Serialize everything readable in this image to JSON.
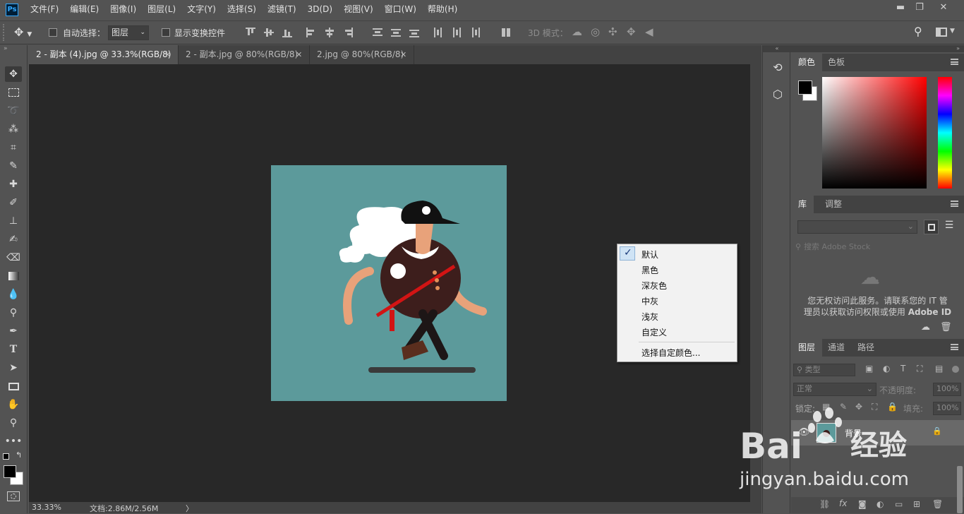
{
  "app": {
    "logo": "Ps"
  },
  "menu": [
    "文件(F)",
    "编辑(E)",
    "图像(I)",
    "图层(L)",
    "文字(Y)",
    "选择(S)",
    "滤镜(T)",
    "3D(D)",
    "视图(V)",
    "窗口(W)",
    "帮助(H)"
  ],
  "window": {
    "minimize": "▬",
    "restore": "❐",
    "close": "✕"
  },
  "options": {
    "auto_select_label": "自动选择：",
    "auto_select_value": "图层",
    "show_transform_label": "显示变换控件",
    "mode_3d_label": "3D 模式："
  },
  "tabs": [
    {
      "label": "2 - 副本 (4).jpg @ 33.3%(RGB/8)",
      "close": "✕"
    },
    {
      "label": "2 - 副本.jpg @ 80%(RGB/8)",
      "close": "✕"
    },
    {
      "label": "2.jpg @ 80%(RGB/8)",
      "close": "✕"
    }
  ],
  "context_menu": {
    "items": [
      {
        "label": "默认",
        "checked": true
      },
      {
        "label": "黑色"
      },
      {
        "label": "深灰色"
      },
      {
        "label": "中灰"
      },
      {
        "label": "浅灰"
      },
      {
        "label": "自定义"
      }
    ],
    "custom_color": "选择自定颜色..."
  },
  "status": {
    "zoom": "33.33%",
    "doc": "文档:2.86M/2.56M",
    "arrow": "〉"
  },
  "panels": {
    "color": {
      "tabs": [
        "颜色",
        "色板"
      ],
      "fg": "#000000",
      "bg": "#ffffff"
    },
    "library": {
      "tabs": [
        "库",
        "调整"
      ],
      "search_placeholder": "搜索 Adobe Stock",
      "message_line1": "您无权访问此服务。请联系您的 IT 管",
      "message_line2": "理员以获取访问权限或使用",
      "message_bold": "Adobe ID"
    },
    "layers": {
      "tabs": [
        "图层",
        "通道",
        "路径"
      ],
      "filter": "类型",
      "blend": "正常",
      "opacity_label": "不透明度:",
      "opacity_value": "100%",
      "lock_label": "锁定:",
      "fill_label": "填充:",
      "fill_value": "100%",
      "layer_name": "背景",
      "fx": "fx"
    }
  },
  "watermark": {
    "brand": "Bai",
    "brand2": "经验",
    "url": "jingyan.baidu.com"
  },
  "colors": {
    "accent": "#31a8ff",
    "canvas_bg": "#5c9a9b",
    "arrow": "#e63b3b"
  }
}
